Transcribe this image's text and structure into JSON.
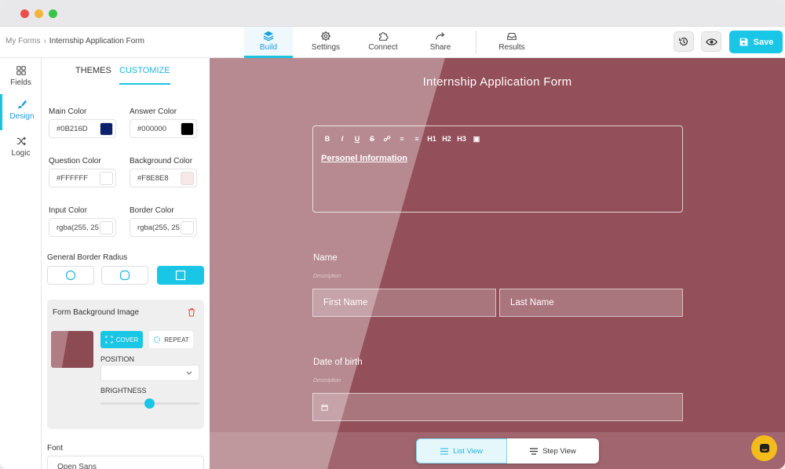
{
  "breadcrumb": {
    "root": "My Forms",
    "separator": "›",
    "current": "Internship Application Form"
  },
  "nav_tabs": [
    {
      "label": "Build",
      "icon": "layers-icon",
      "active": true
    },
    {
      "label": "Settings",
      "icon": "gear-icon",
      "active": false
    },
    {
      "label": "Connect",
      "icon": "puzzle-icon",
      "active": false
    },
    {
      "label": "Share",
      "icon": "share-icon",
      "active": false
    },
    {
      "label": "Results",
      "icon": "inbox-icon",
      "active": false
    }
  ],
  "toolbar": {
    "history_icon": "history-icon",
    "preview_icon": "eye-icon",
    "save_label": "Save"
  },
  "left_rail": [
    {
      "label": "Fields",
      "icon": "grid-icon",
      "active": false
    },
    {
      "label": "Design",
      "icon": "brush-icon",
      "active": true
    },
    {
      "label": "Logic",
      "icon": "shuffle-icon",
      "active": false
    }
  ],
  "panel": {
    "tabs": [
      {
        "label": "THEMES",
        "active": false
      },
      {
        "label": "CUSTOMIZE",
        "active": true
      }
    ],
    "colors": {
      "main": {
        "label": "Main Color",
        "value": "#0B216D",
        "swatch": "#0B216D"
      },
      "answer": {
        "label": "Answer Color",
        "value": "#000000",
        "swatch": "#000000"
      },
      "question": {
        "label": "Question Color",
        "value": "#FFFFFF",
        "swatch": "#FFFFFF"
      },
      "background": {
        "label": "Background Color",
        "value": "#F8E8E8",
        "swatch": "#F8E8E8"
      },
      "input": {
        "label": "Input Color",
        "value": "rgba(255, 25",
        "swatch": "#FFFFFF"
      },
      "border": {
        "label": "Border Color",
        "value": "rgba(255, 25",
        "swatch": "#FFFFFF"
      }
    },
    "border_radius": {
      "label": "General Border Radius",
      "options": [
        "round",
        "rounded",
        "square"
      ],
      "selected": "square"
    },
    "bg_image": {
      "title": "Form Background Image",
      "cover_label": "COVER",
      "repeat_label": "REPEAT",
      "position_label": "POSITION",
      "position_value": "",
      "brightness_label": "BRIGHTNESS",
      "brightness": 0.5
    },
    "font": {
      "label": "Font",
      "value": "Open Sans"
    }
  },
  "form": {
    "title": "Internship Application Form",
    "editor_toolbar": [
      "B",
      "I",
      "U",
      "S",
      "link",
      "ol",
      "ul",
      "H1",
      "H2",
      "H3",
      "image"
    ],
    "editor_text": "Personel Information",
    "name_label": "Name",
    "name_desc": "Description",
    "first_name_placeholder": "First Name",
    "last_name_placeholder": "Last Name",
    "dob_label": "Date of birth",
    "dob_desc": "Description"
  },
  "view_toggle": {
    "list_label": "List View",
    "step_label": "Step View",
    "active": "list"
  },
  "colors": {
    "accent": "#1AC6E6",
    "canvas": "#9A565F",
    "chat": "#F4BB1C"
  }
}
